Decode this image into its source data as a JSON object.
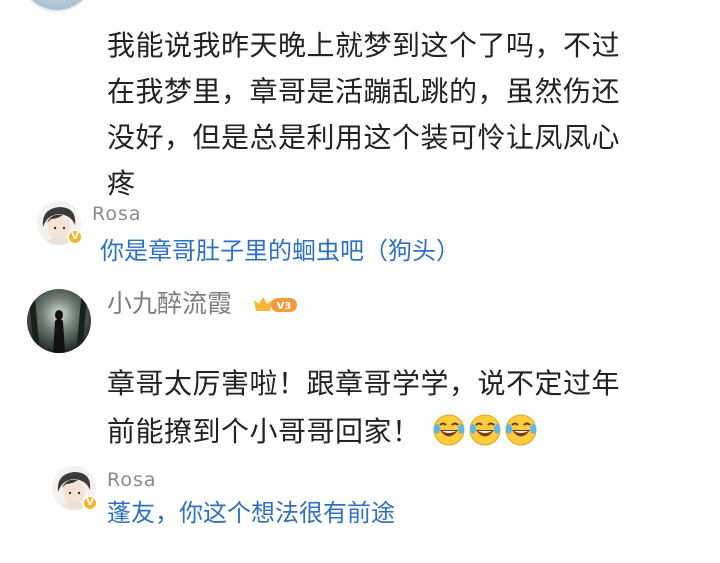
{
  "comment": {
    "lines": [
      "我能说我昨天晚上就梦到这个了吗，不过",
      "在我梦里，章哥是活蹦乱跳的，虽然伤还",
      "没好，但是总是利用这个装可怜让凤凤心",
      "疼"
    ]
  },
  "reply1": {
    "name": "Rosa",
    "text": "你是章哥肚子里的蛔虫吧（狗头）",
    "badge": "V"
  },
  "user": {
    "name": "小九醉流霞",
    "level": "V3"
  },
  "comment2": {
    "lines": [
      "章哥太厉害啦！跟章哥学学，说不定过年",
      "前能撩到个小哥哥回家！"
    ],
    "emojis": [
      "laugh-cry-emoji",
      "laugh-cry-emoji",
      "laugh-cry-emoji"
    ]
  },
  "reply2": {
    "name": "Rosa",
    "text": "蓬友，你这个想法很有前途",
    "badge": "V"
  },
  "colors": {
    "reply_text": "#2f6fc4",
    "name_gray": "#8a8a8a",
    "badge_gold": "#f4b52c"
  }
}
